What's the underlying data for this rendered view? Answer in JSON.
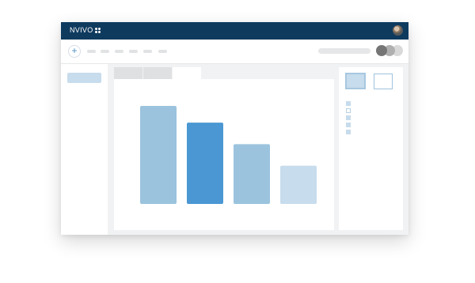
{
  "app": {
    "logo_text": "NVIVO",
    "logo_icon": "four-dots-grid-icon",
    "avatar_icon": "user-avatar-icon"
  },
  "toolbar": {
    "add_button_icon": "plus-icon",
    "add_button_glyph": "+",
    "menu_items_count": 6
  },
  "colors": {
    "titlebar": "#0e3a5e",
    "accent_blue": "#4a97d3",
    "bar_light": "#9bc3de",
    "bar_pale": "#c7dcec",
    "toggle_dark": "#757575",
    "toggle_mid": "#b0b0b0",
    "toggle_light": "#d9d9d9"
  },
  "right_pane": {
    "thumbnails": [
      "selected",
      "unselected"
    ],
    "controls": [
      "filled",
      "outline",
      "filled",
      "filled",
      "filled"
    ]
  },
  "chart_data": {
    "type": "bar",
    "categories": [
      "",
      "",
      "",
      ""
    ],
    "values": [
      100,
      83,
      61,
      39
    ],
    "ylim": [
      0,
      100
    ],
    "grid": false,
    "legend": "none",
    "title": "",
    "xlabel": "",
    "ylabel": "",
    "bar_colors": [
      "#9bc3de",
      "#4a97d3",
      "#9bc3de",
      "#c7dcec"
    ]
  }
}
